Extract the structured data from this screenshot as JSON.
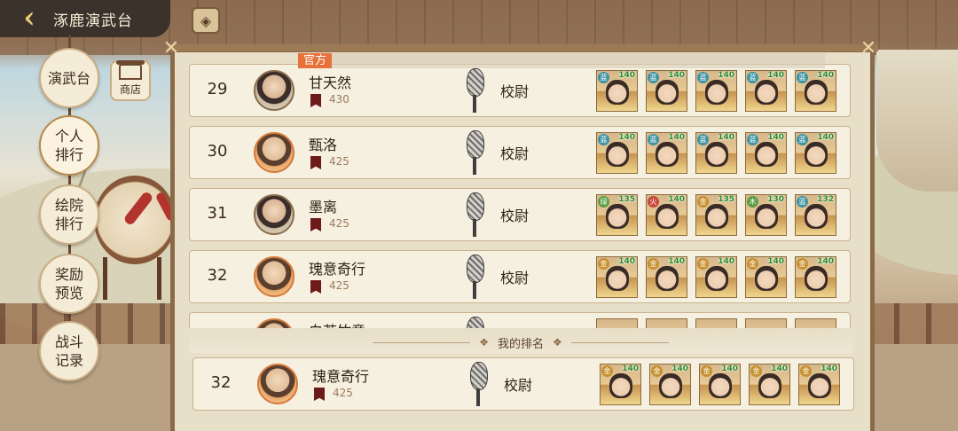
{
  "header": {
    "title": "涿鹿演武台",
    "back_icon": "chevron-left-icon"
  },
  "nav": [
    {
      "label": "演武台",
      "active": false
    },
    {
      "label": "个人\n排行",
      "active": true
    },
    {
      "label": "绘院\n排行",
      "active": false
    },
    {
      "label": "奖励\n预览",
      "active": false
    },
    {
      "label": "战斗\n记录",
      "active": false
    }
  ],
  "shop": {
    "label": "商店"
  },
  "list": {
    "ribbon_label": "官方"
  },
  "rows": [
    {
      "rank": "29",
      "name": "甘天然",
      "score": "430",
      "title": "校尉",
      "frame": "plain",
      "team": [
        {
          "badge": "蓝",
          "level": "140",
          "color": "cyan"
        },
        {
          "badge": "蓝",
          "level": "140",
          "color": "cyan"
        },
        {
          "badge": "蓝",
          "level": "140",
          "color": "cyan"
        },
        {
          "badge": "蓝",
          "level": "140",
          "color": "cyan"
        },
        {
          "badge": "蓝",
          "level": "140",
          "color": "cyan"
        }
      ]
    },
    {
      "rank": "30",
      "name": "甄洛",
      "score": "425",
      "title": "校尉",
      "frame": "gold",
      "team": [
        {
          "badge": "蓝",
          "level": "140",
          "color": "cyan"
        },
        {
          "badge": "蓝",
          "level": "140",
          "color": "cyan"
        },
        {
          "badge": "蓝",
          "level": "140",
          "color": "cyan"
        },
        {
          "badge": "蓝",
          "level": "140",
          "color": "cyan"
        },
        {
          "badge": "蓝",
          "level": "140",
          "color": "cyan"
        }
      ]
    },
    {
      "rank": "31",
      "name": "墨离",
      "score": "425",
      "title": "校尉",
      "frame": "plain",
      "team": [
        {
          "badge": "绿",
          "level": "135",
          "color": "green"
        },
        {
          "badge": "火",
          "level": "140",
          "color": "red"
        },
        {
          "badge": "金",
          "level": "135",
          "color": "gold"
        },
        {
          "badge": "木",
          "level": "130",
          "color": "green"
        },
        {
          "badge": "蓝",
          "level": "132",
          "color": "cyan"
        }
      ]
    },
    {
      "rank": "32",
      "name": "瑰意奇行",
      "score": "425",
      "title": "校尉",
      "frame": "gold",
      "team": [
        {
          "badge": "金",
          "level": "140",
          "color": "gold"
        },
        {
          "badge": "金",
          "level": "140",
          "color": "gold"
        },
        {
          "badge": "金",
          "level": "140",
          "color": "gold"
        },
        {
          "badge": "金",
          "level": "140",
          "color": "gold"
        },
        {
          "badge": "金",
          "level": "140",
          "color": "gold"
        }
      ]
    },
    {
      "rank": "",
      "name": "白若竹意",
      "score": "",
      "title": "",
      "frame": "gold",
      "team": [
        {
          "badge": "",
          "level": "",
          "color": "gold"
        },
        {
          "badge": "",
          "level": "",
          "color": "gold"
        },
        {
          "badge": "",
          "level": "",
          "color": "gold"
        },
        {
          "badge": "",
          "level": "",
          "color": "gold"
        },
        {
          "badge": "",
          "level": "",
          "color": "gold"
        }
      ]
    }
  ],
  "my_rank_label": "我的排名",
  "my_row": {
    "rank": "32",
    "name": "瑰意奇行",
    "score": "425",
    "title": "校尉",
    "frame": "gold",
    "team": [
      {
        "badge": "金",
        "level": "140",
        "color": "gold"
      },
      {
        "badge": "金",
        "level": "140",
        "color": "gold"
      },
      {
        "badge": "金",
        "level": "140",
        "color": "gold"
      },
      {
        "badge": "金",
        "level": "140",
        "color": "gold"
      },
      {
        "badge": "金",
        "level": "140",
        "color": "gold"
      }
    ]
  }
}
